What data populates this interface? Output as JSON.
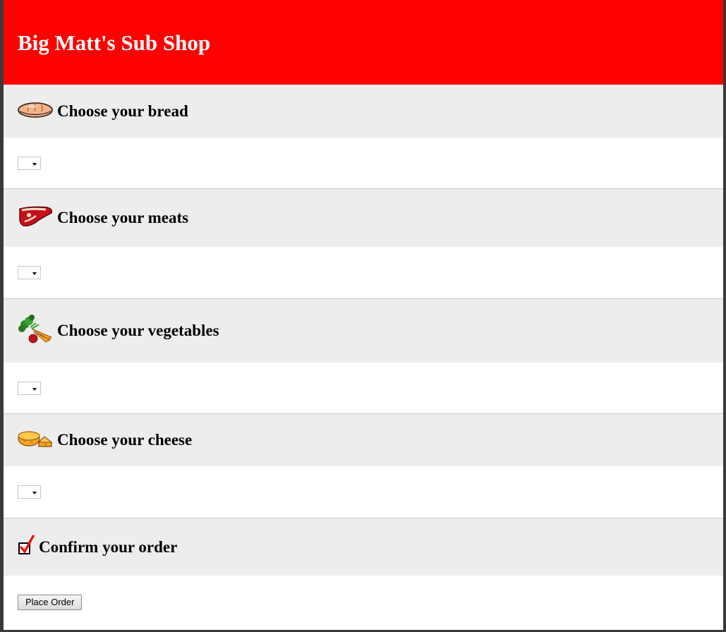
{
  "header": {
    "title": "Big Matt's Sub Shop"
  },
  "colors": {
    "header_bg": "#ff0000",
    "section_bg": "#ededed"
  },
  "sections": [
    {
      "heading": "Choose your bread",
      "icon": "bread-icon",
      "select_value": ""
    },
    {
      "heading": "Choose your meats",
      "icon": "steak-icon",
      "select_value": ""
    },
    {
      "heading": "Choose your vegetables",
      "icon": "vegetables-icon",
      "select_value": ""
    },
    {
      "heading": "Choose your cheese",
      "icon": "cheese-icon",
      "select_value": ""
    },
    {
      "heading": "Confirm your order",
      "icon": "checkbox-checked-icon"
    }
  ],
  "order": {
    "button_label": "Place Order"
  }
}
